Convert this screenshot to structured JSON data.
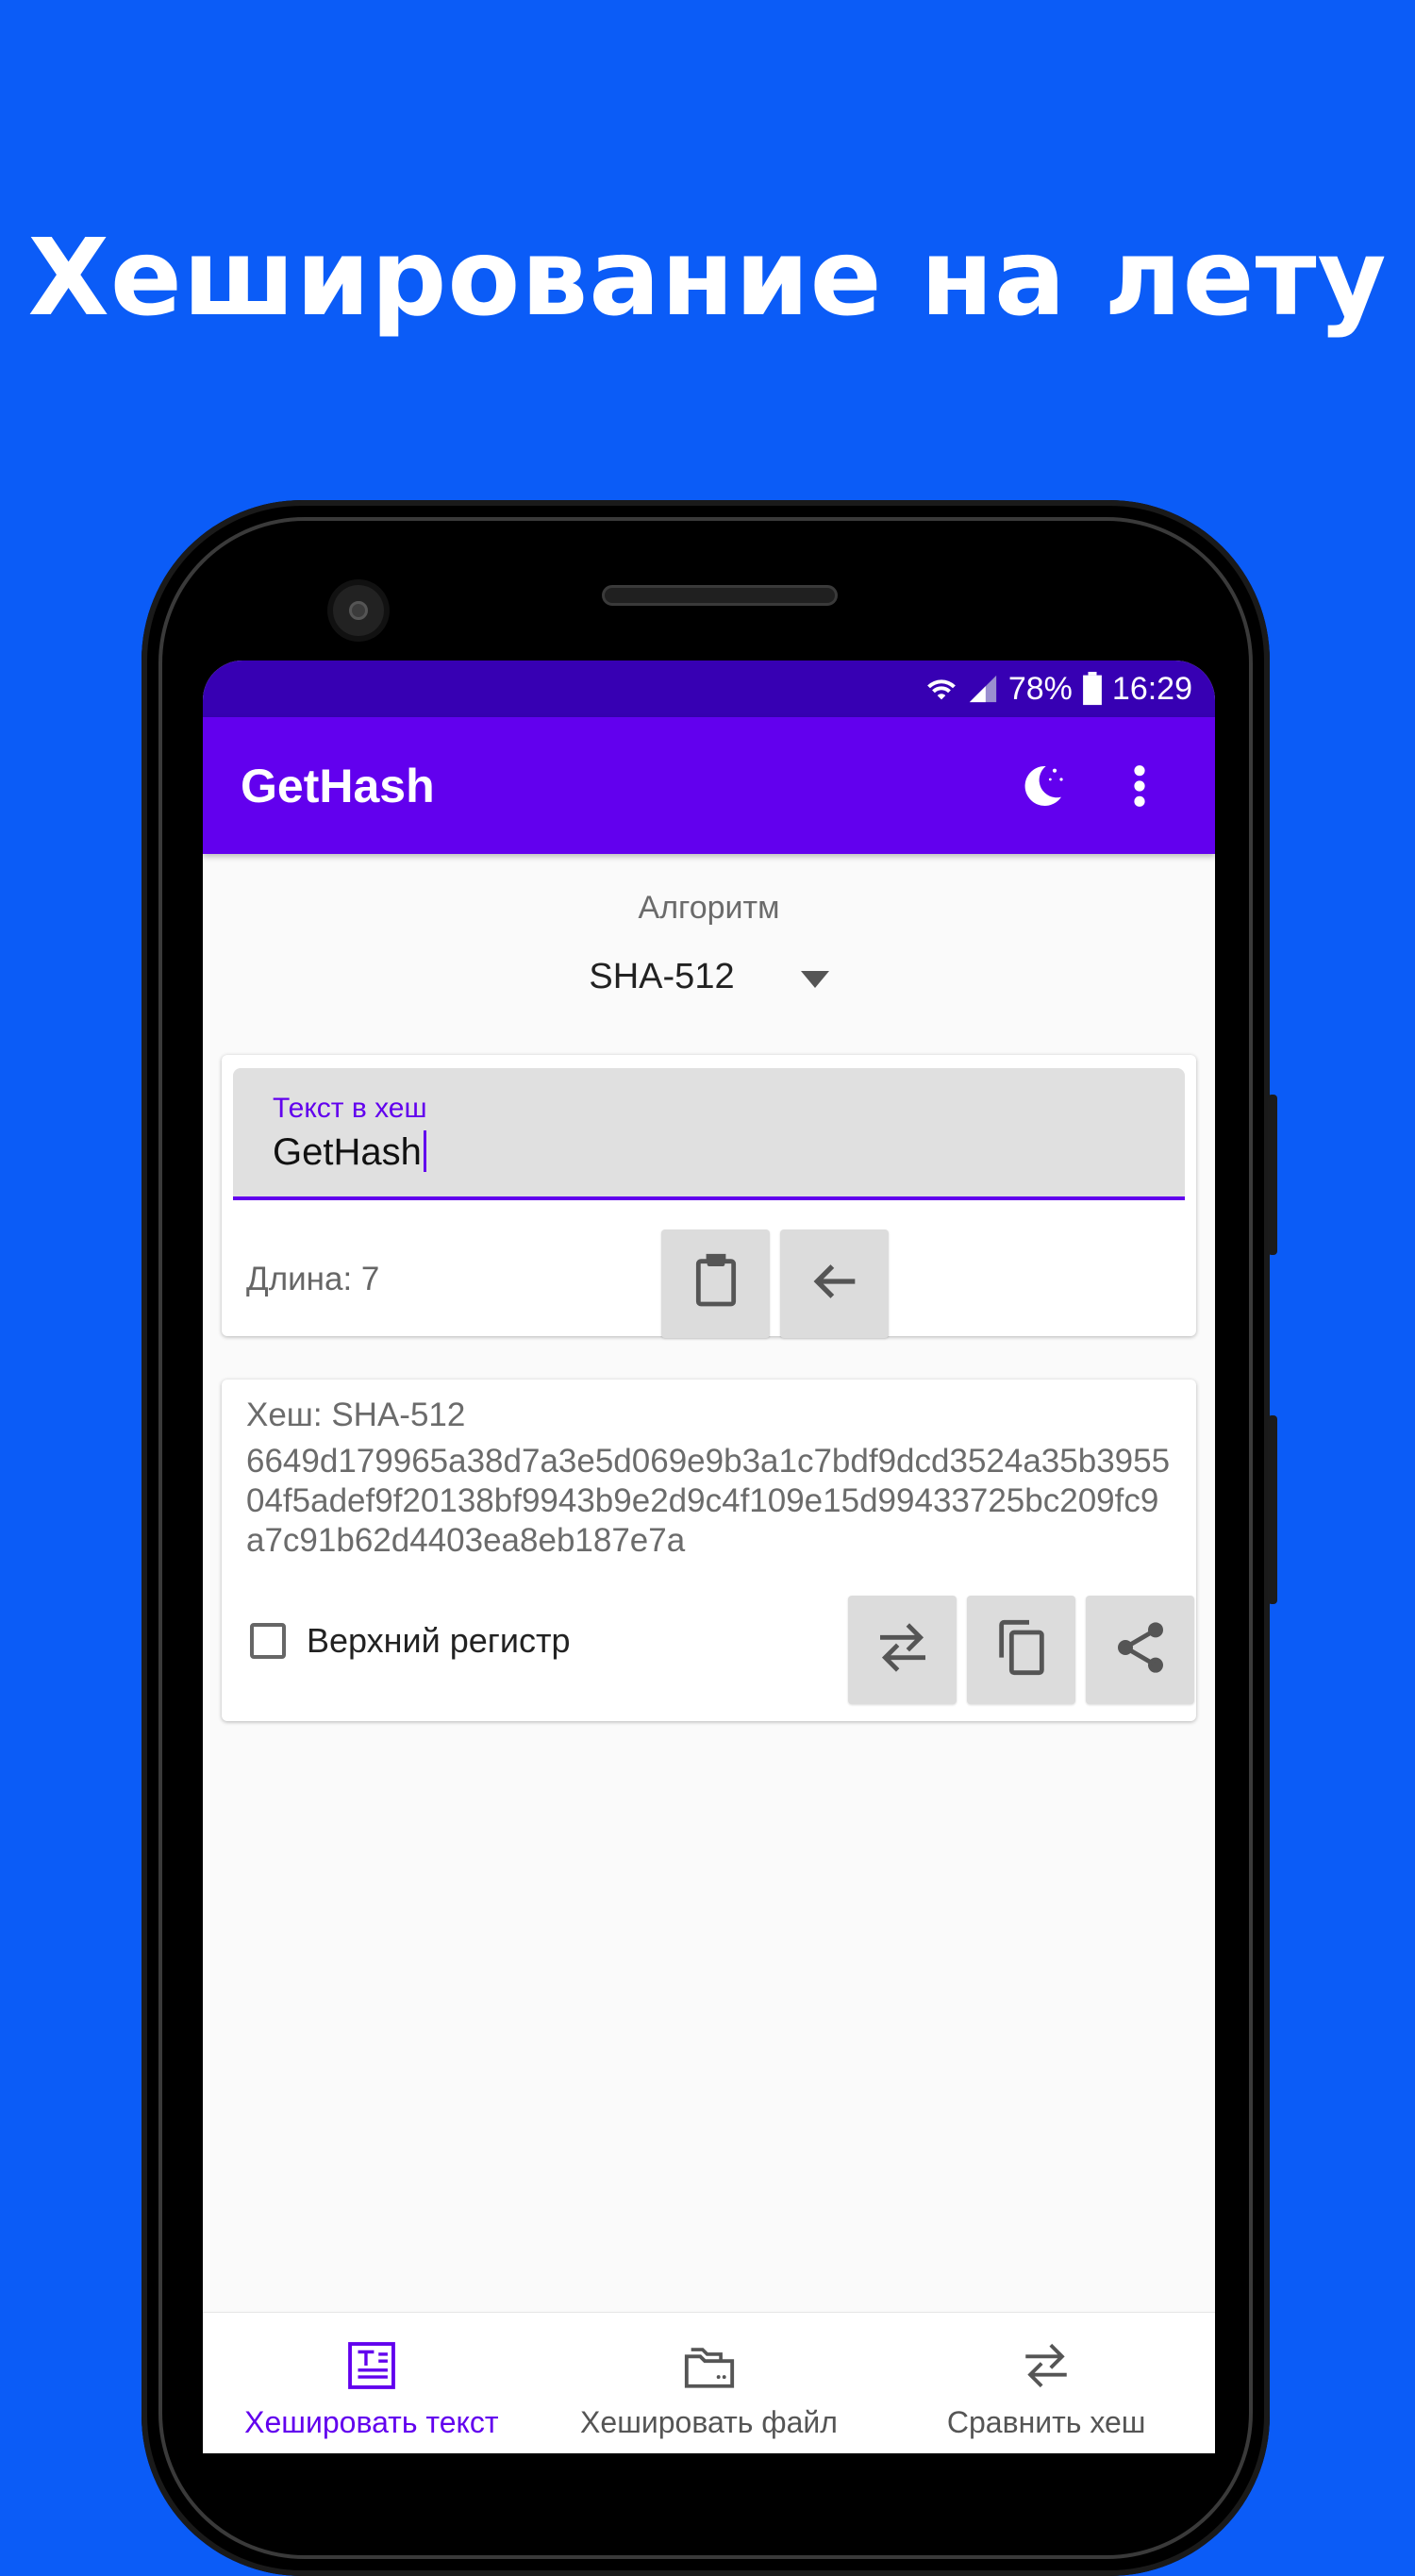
{
  "headline": "Хеширование на лету",
  "status_bar": {
    "battery": "78%",
    "time": "16:29",
    "icons": [
      "wifi-icon",
      "signal-icon",
      "battery-icon"
    ]
  },
  "app_bar": {
    "title": "GetHash",
    "actions": [
      "night-mode-moon-icon",
      "more-vert-icon"
    ]
  },
  "algorithm": {
    "label": "Алгоритм",
    "selected": "SHA-512"
  },
  "input_card": {
    "field_label": "Текст в хеш",
    "field_value": "GetHash",
    "length_text": "Длина: 7",
    "buttons": [
      "paste-clipboard-icon",
      "backspace-arrow-icon"
    ]
  },
  "hash_card": {
    "title": "Хеш: SHA-512",
    "value": "6649d179965a38d7a3e5d069e9b3a1c7bdf9dcd3524a35b395504f5adef9f20138bf9943b9e2d9c4f109e15d99433725bc209fc9a7c91b62d4403ea8eb187e7a",
    "uppercase_label": "Верхний регистр",
    "uppercase_checked": false,
    "buttons": [
      "compare-arrows-icon",
      "copy-icon",
      "share-icon"
    ]
  },
  "bottom_nav": {
    "items": [
      {
        "label": "Хешировать текст",
        "icon": "text-document-icon",
        "active": true
      },
      {
        "label": "Хешировать файл",
        "icon": "folder-file-icon",
        "active": false
      },
      {
        "label": "Сравнить хеш",
        "icon": "compare-arrows-icon",
        "active": false
      }
    ]
  },
  "colors": {
    "background": "#0b5cf7",
    "status_bar": "#3700b3",
    "app_bar": "#6200ee",
    "accent": "#6200ee"
  }
}
